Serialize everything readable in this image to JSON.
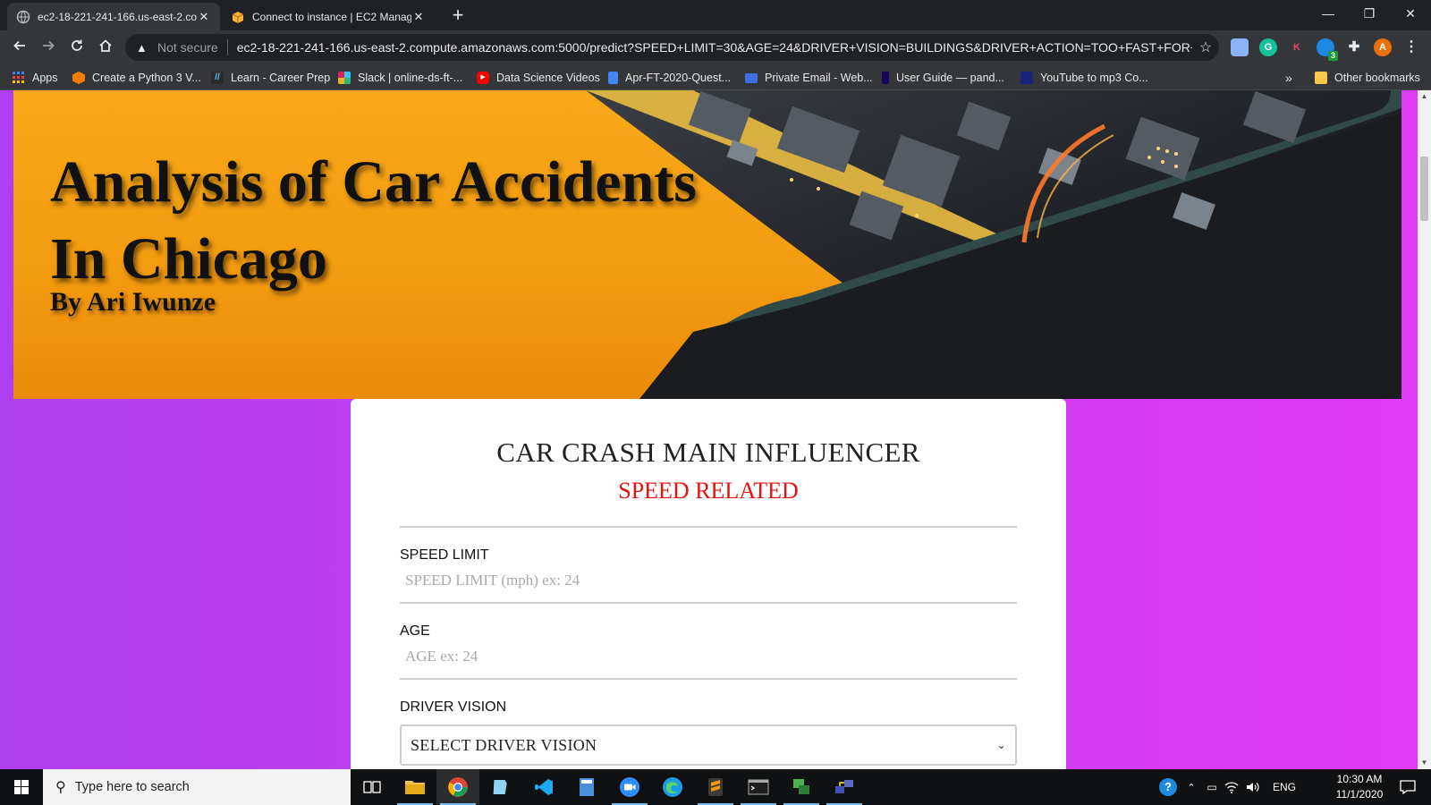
{
  "browser": {
    "tabs": [
      {
        "title": "ec2-18-221-241-166.us-east-2.co",
        "active": true
      },
      {
        "title": "Connect to instance | EC2 Manag",
        "active": false
      }
    ],
    "new_tab": "+",
    "window_controls": {
      "minimize": "—",
      "restore": "❐",
      "close": "✕"
    },
    "security_label": "Not secure",
    "url": "ec2-18-221-241-166.us-east-2.compute.amazonaws.com:5000/predict?SPEED+LIMIT=30&AGE=24&DRIVER+VISION=BUILDINGS&DRIVER+ACTION=TOO+FAST+FOR+CO...",
    "profile_initial": "A",
    "extension_badge": "3",
    "bookmarks": [
      {
        "label": "Apps",
        "icon": "apps-grid-icon",
        "color": "#4285f4"
      },
      {
        "label": "Create a Python 3 V...",
        "icon": "hexagon-icon",
        "color": "#f57c00"
      },
      {
        "label": "Learn - Career Prep",
        "icon": "learn-icon",
        "color": "#2b2b2b"
      },
      {
        "label": "Slack | online-ds-ft-...",
        "icon": "slack-icon",
        "color": "#e01e5a"
      },
      {
        "label": "Data Science Videos",
        "icon": "youtube-icon",
        "color": "#ff0000"
      },
      {
        "label": "Apr-FT-2020-Quest...",
        "icon": "docs-icon",
        "color": "#4285f4"
      },
      {
        "label": "Private Email - Web...",
        "icon": "mail-icon",
        "color": "#3d6fe0"
      },
      {
        "label": "User Guide — pand...",
        "icon": "pandas-icon",
        "color": "#150458"
      },
      {
        "label": "YouTube to mp3 Co...",
        "icon": "mp3-icon",
        "color": "#1a237e"
      }
    ],
    "bookmarks_overflow": "»",
    "other_bookmarks": "Other bookmarks"
  },
  "page": {
    "banner": {
      "title": "Analysis of Car Accidents In Chicago",
      "byline": "By Ari Iwunze"
    },
    "card": {
      "heading": "CAR CRASH MAIN INFLUENCER",
      "result": "SPEED RELATED",
      "speed_limit": {
        "label": "SPEED LIMIT",
        "placeholder": "SPEED LIMIT (mph) ex: 24",
        "value": ""
      },
      "age": {
        "label": "AGE",
        "placeholder": "AGE ex: 24",
        "value": ""
      },
      "driver_vision": {
        "label": "DRIVER VISION",
        "selected": "SELECT DRIVER VISION"
      }
    },
    "colors": {
      "result": "#e81010",
      "bg_left": "#b03ff0",
      "bg_right": "#e03af5",
      "banner": "#f39c10"
    }
  },
  "taskbar": {
    "search_placeholder": "Type here to search",
    "apps": [
      "task-view-icon",
      "file-explorer-icon",
      "chrome-icon",
      "notepad-icon",
      "vscode-icon",
      "calculator-icon",
      "zoom-icon",
      "edge-icon",
      "sublime-icon",
      "terminal-icon",
      "vpn-icon",
      "network-icon"
    ],
    "language": "ENG",
    "time": "10:30 AM",
    "date": "11/1/2020"
  }
}
